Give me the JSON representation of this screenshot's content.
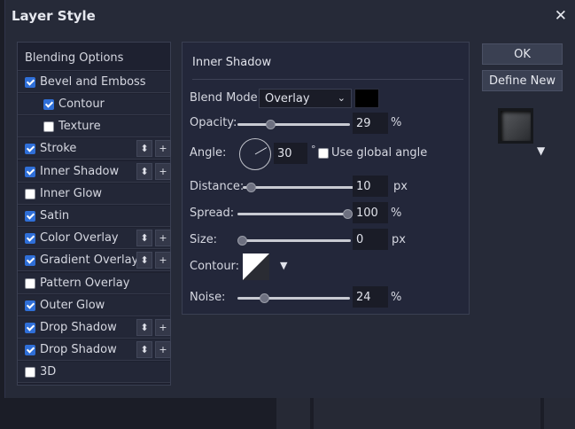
{
  "dialog": {
    "title": "Layer Style",
    "close_glyph": "✕"
  },
  "styles": [
    {
      "label": "Blending Options",
      "header": true
    },
    {
      "label": "Bevel and Emboss",
      "checked": true
    },
    {
      "label": "Contour",
      "checked": true,
      "indent": true
    },
    {
      "label": "Texture",
      "checked": false,
      "indent": true
    },
    {
      "label": "Stroke",
      "checked": true,
      "stackable": true
    },
    {
      "label": "Inner Shadow",
      "checked": true,
      "stackable": true
    },
    {
      "label": "Inner Glow",
      "checked": false
    },
    {
      "label": "Satin",
      "checked": true
    },
    {
      "label": "Color Overlay",
      "checked": true,
      "stackable": true
    },
    {
      "label": "Gradient Overlay",
      "checked": true,
      "stackable": true
    },
    {
      "label": "Pattern Overlay",
      "checked": false
    },
    {
      "label": "Outer Glow",
      "checked": true
    },
    {
      "label": "Drop Shadow",
      "checked": true,
      "stackable": true
    },
    {
      "label": "Drop Shadow",
      "checked": true,
      "stackable": true
    },
    {
      "label": "3D",
      "checked": false
    }
  ],
  "stack_glyphs": {
    "reorder": "⬍",
    "add": "+"
  },
  "panel": {
    "title": "Inner Shadow",
    "blend_mode": {
      "label": "Blend Mode:",
      "value": "Overlay",
      "color": "#000000"
    },
    "opacity": {
      "label": "Opacity:",
      "value": "29",
      "unit": "%",
      "fraction": 0.29
    },
    "angle": {
      "label": "Angle:",
      "value": "30",
      "unit": "°",
      "degrees": 30,
      "global_label": "Use global angle",
      "global_checked": false
    },
    "distance": {
      "label": "Distance:",
      "value": "10",
      "unit": "px",
      "fraction": 0.07
    },
    "spread": {
      "label": "Spread:",
      "value": "100",
      "unit": "%",
      "fraction": 1.0
    },
    "size": {
      "label": "Size:",
      "value": "0",
      "unit": "px",
      "fraction": 0.0
    },
    "contour": {
      "label": "Contour:"
    },
    "noise": {
      "label": "Noise:",
      "value": "24",
      "unit": "%",
      "fraction": 0.24
    }
  },
  "buttons": {
    "ok": "OK",
    "define_new": "Define New"
  },
  "dropdown_glyph": "▼"
}
